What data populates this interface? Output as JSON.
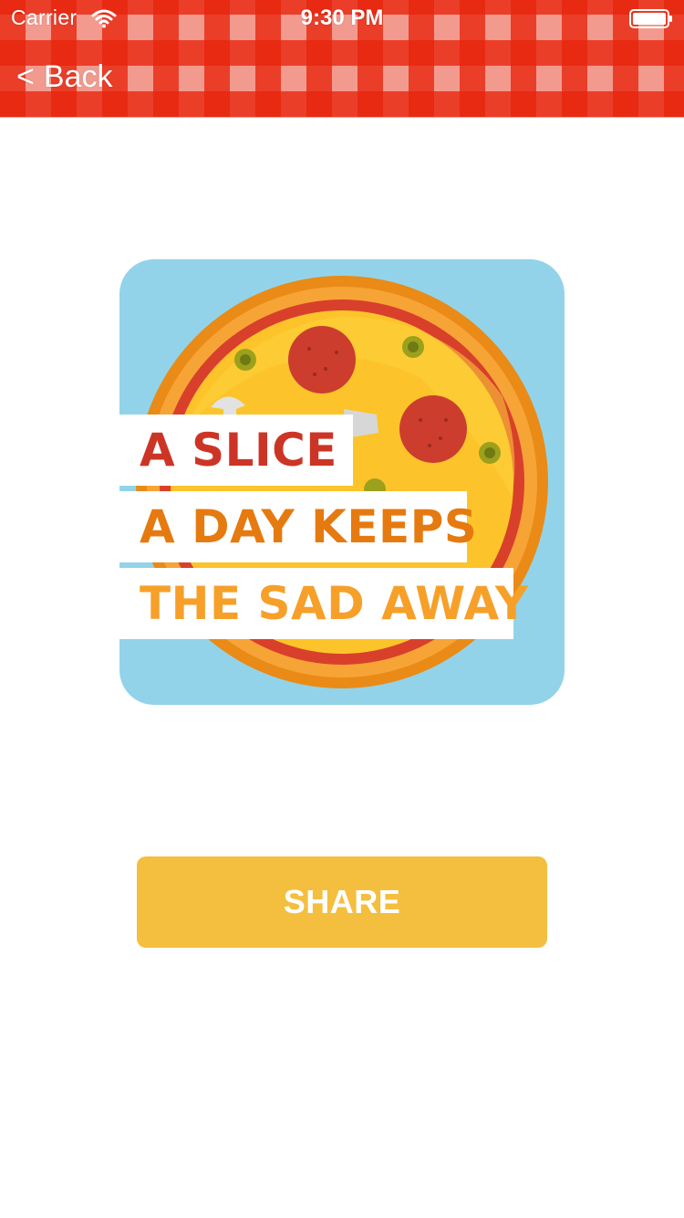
{
  "status_bar": {
    "carrier": "Carrier",
    "time": "9:30 PM",
    "wifi_icon": "wifi-icon",
    "battery_icon": "battery-icon"
  },
  "nav": {
    "back_chevron": "<",
    "back_label": "Back"
  },
  "card": {
    "background_color": "#93d3ea",
    "image": "pizza-illustration",
    "quote_lines": [
      "A SLICE",
      "A DAY KEEPS",
      "THE SAD AWAY"
    ]
  },
  "share": {
    "label": "SHARE",
    "color": "#f4bf3f"
  },
  "colors": {
    "header_red": "#e7240c",
    "quote_red": "#cc3526",
    "quote_orange": "#e57a10",
    "quote_light_orange": "#f6a02a"
  }
}
